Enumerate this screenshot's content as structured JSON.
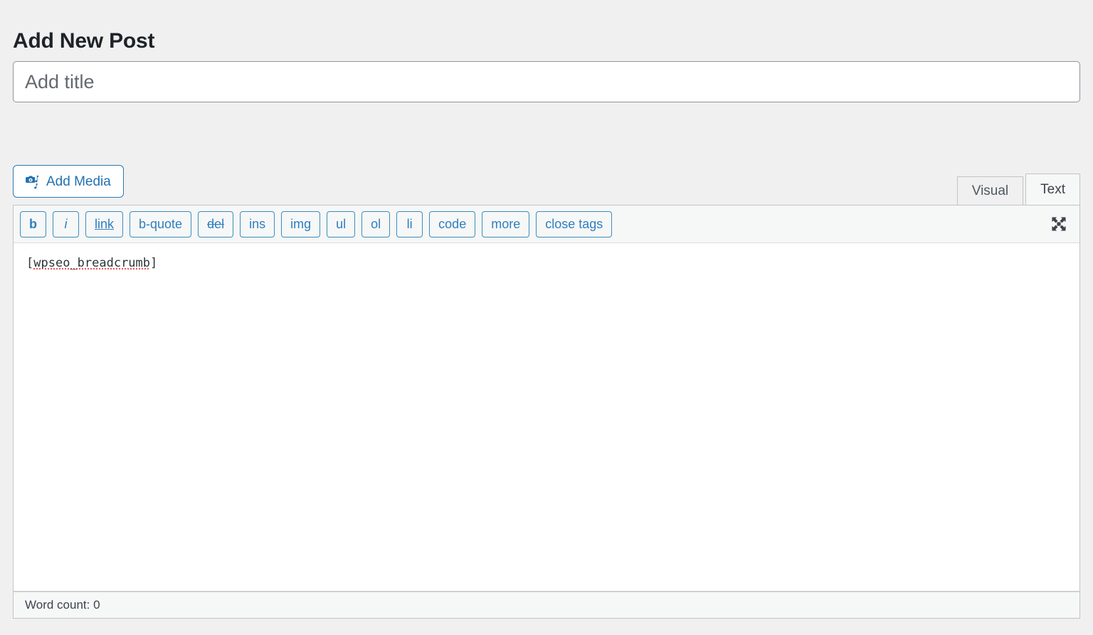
{
  "page": {
    "title": "Add New Post"
  },
  "title_field": {
    "placeholder": "Add title",
    "value": ""
  },
  "toolbar": {
    "add_media_label": "Add Media",
    "add_media_icon": "camera-music-media-icon",
    "fullscreen_icon": "fullscreen-expand-icon"
  },
  "tabs": [
    {
      "label": "Visual",
      "active": false
    },
    {
      "label": "Text",
      "active": true
    }
  ],
  "quicktags": [
    {
      "label": "b",
      "style": "b",
      "name": "bold"
    },
    {
      "label": "i",
      "style": "i",
      "name": "italic"
    },
    {
      "label": "link",
      "style": "u",
      "name": "link"
    },
    {
      "label": "b-quote",
      "style": "",
      "name": "blockquote"
    },
    {
      "label": "del",
      "style": "s",
      "name": "del"
    },
    {
      "label": "ins",
      "style": "",
      "name": "ins"
    },
    {
      "label": "img",
      "style": "",
      "name": "img"
    },
    {
      "label": "ul",
      "style": "",
      "name": "ul"
    },
    {
      "label": "ol",
      "style": "",
      "name": "ol"
    },
    {
      "label": "li",
      "style": "",
      "name": "li"
    },
    {
      "label": "code",
      "style": "",
      "name": "code"
    },
    {
      "label": "more",
      "style": "",
      "name": "more"
    },
    {
      "label": "close tags",
      "style": "",
      "name": "close-tags"
    }
  ],
  "editor": {
    "content_prefix": "[",
    "content_word": "wpseo_breadcrumb",
    "content_suffix": "]",
    "content_full": "[wpseo_breadcrumb]"
  },
  "status": {
    "word_count_label": "Word count: 0"
  },
  "colors": {
    "page_background": "#f0f0f1",
    "accent_blue": "#2271b1",
    "quicktag_border": "#3c8dbc",
    "panel_border": "#c3c4c7",
    "spellcheck_red": "#e8554e",
    "text_dark": "#1d2327"
  }
}
